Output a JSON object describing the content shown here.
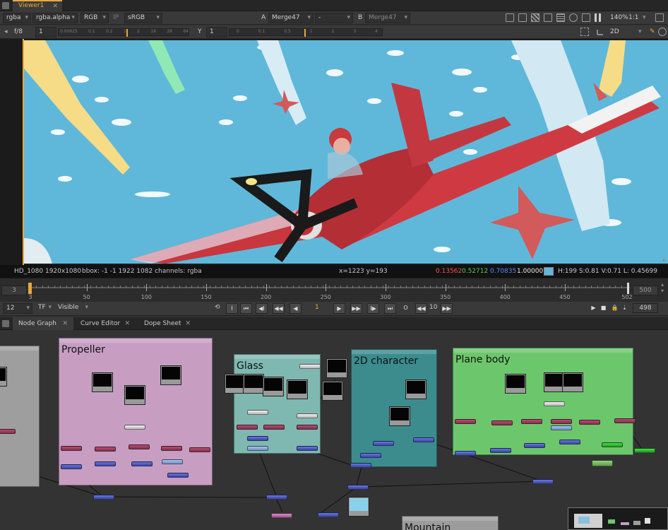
{
  "viewer_tab": {
    "label": "Viewer1",
    "close": "✕"
  },
  "controls": {
    "channels": "rgba",
    "alpha": "rgba.alpha",
    "display": "RGB",
    "ip_label": "IP",
    "colorspace": "sRGB",
    "a_label": "A",
    "a_input": "Merge47",
    "wipe": "-",
    "b_label": "B",
    "b_input": "Merge47",
    "zoom": "140%",
    "ratio": "1:1",
    "fstop": "f/8",
    "gain_value": "1",
    "gain_ticks": [
      "0.00625",
      "0.1",
      "0.2",
      "1",
      "2",
      "16",
      "28",
      "64"
    ],
    "y_label": "Y",
    "gamma_value": "1",
    "gamma_ticks": [
      "0",
      "0.1",
      "0.5",
      "1",
      "2",
      "3",
      "4"
    ],
    "view_mode": "2D"
  },
  "info": {
    "format": "HD_1080 1920x1080",
    "bbox": "bbox: -1 -1 1922 1082 channels: rgba",
    "coords": "x=1223 y=193",
    "r": "0.13562",
    "g": "0.52712",
    "b": "0.70835",
    "a": "1.00000",
    "hsv": "H:199 S:0.81 V:0.71  L: 0.45699",
    "swatch_color": "#5fb8da"
  },
  "timeline": {
    "in_frame": "3",
    "out_frame": "500",
    "ticks": [
      "3",
      "50",
      "100",
      "150",
      "200",
      "250",
      "300",
      "350",
      "400",
      "450",
      "502"
    ],
    "current": "1"
  },
  "playback": {
    "fps": "12",
    "tf": "TF",
    "visible": "Visible",
    "current_frame": "1",
    "step": "10",
    "end_frame": "498",
    "btn_in": "I",
    "btn_out": "O"
  },
  "colors": {
    "accent": "#e8a93a",
    "red_value": "#ff5050",
    "green_value": "#4fd04f",
    "blue_value": "#5a8cff"
  },
  "node_tabs": [
    "Node Graph",
    "Curve Editor",
    "Dope Sheet"
  ],
  "backdrops": [
    {
      "title": "Propeller"
    },
    {
      "title": "Glass"
    },
    {
      "title": "2D character"
    },
    {
      "title": "Plane body"
    },
    {
      "title": "Mountain"
    }
  ]
}
